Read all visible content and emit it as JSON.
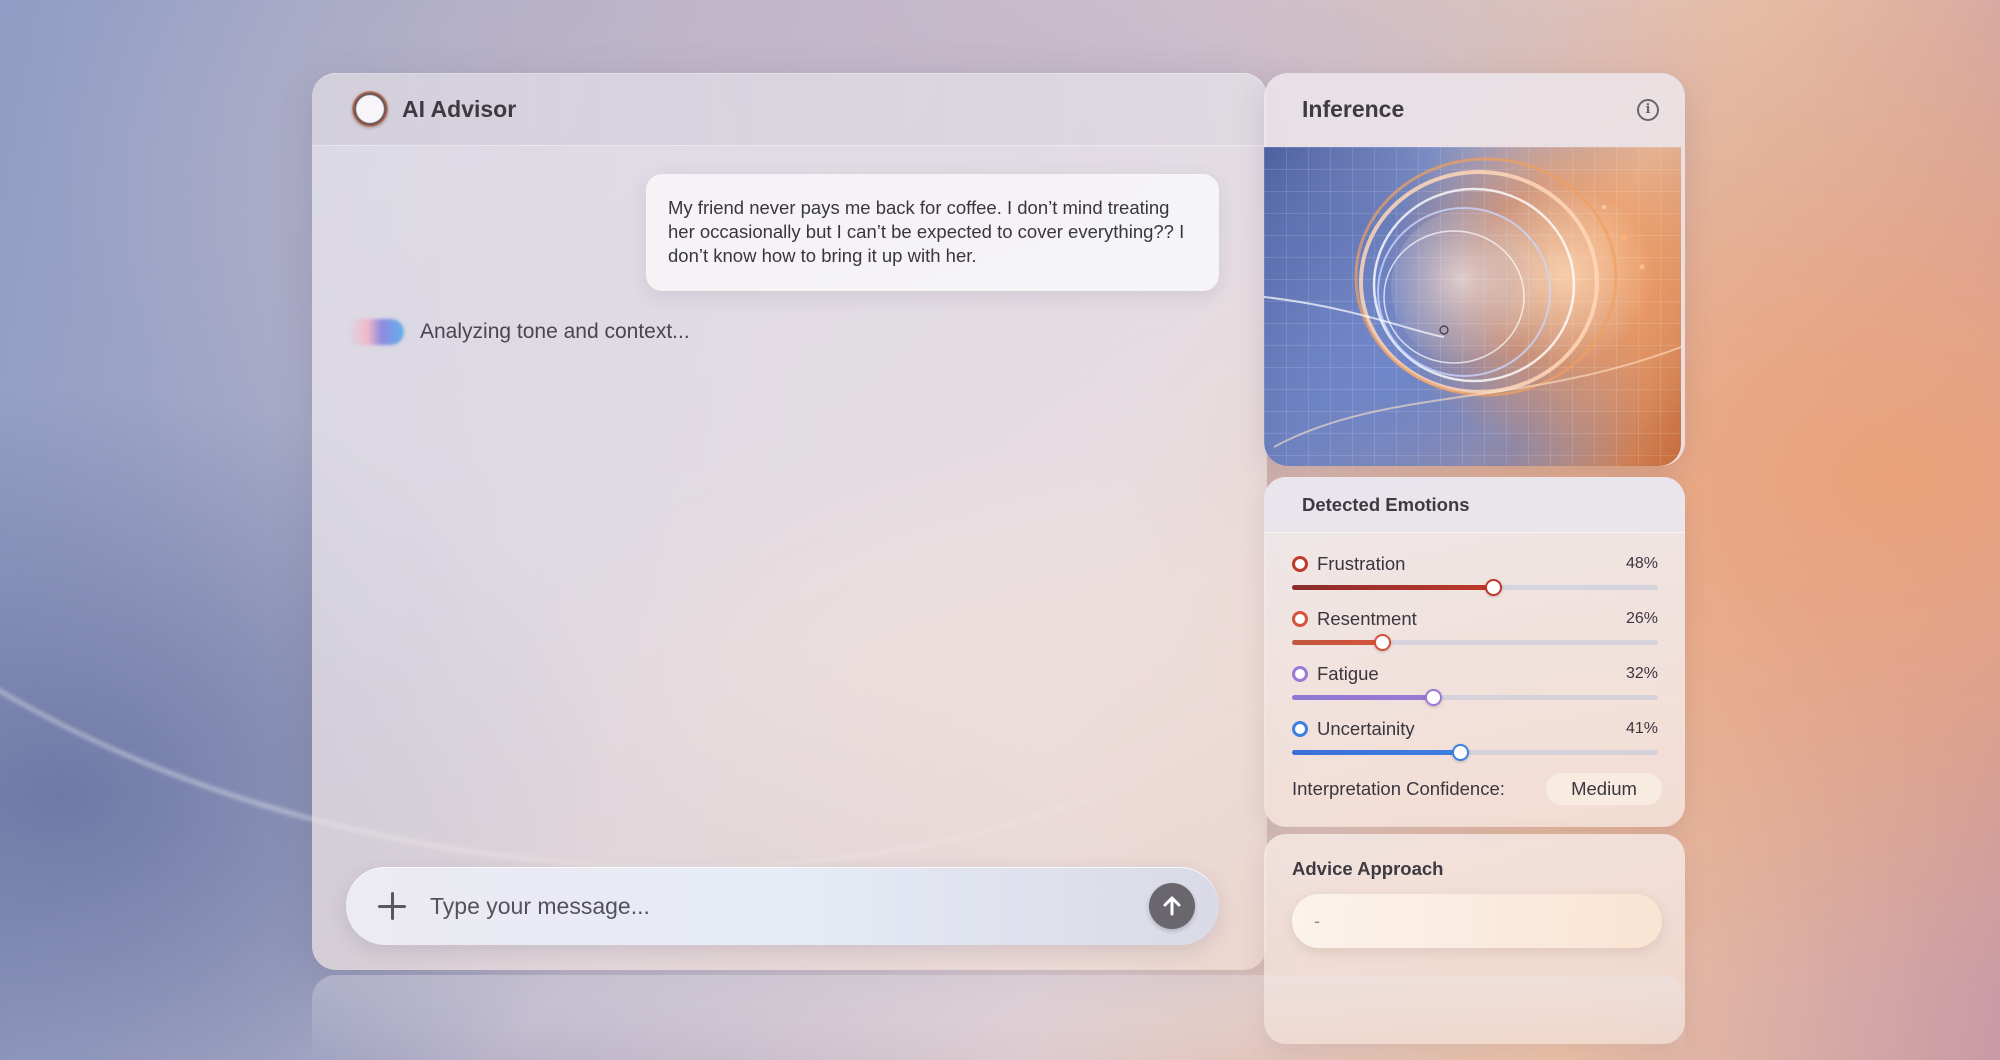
{
  "app": {
    "title": "AI Advisor"
  },
  "chat": {
    "user_message": "My friend never pays me back for coffee. I don’t mind treating her occasionally but I can’t be expected to cover everything?? I don’t know how to bring it up with her.",
    "status_text": "Analyzing tone and context...",
    "composer_placeholder": "Type your message..."
  },
  "inference": {
    "title": "Inference",
    "info_icon": "info-icon"
  },
  "emotions": {
    "title": "Detected Emotions",
    "items": [
      {
        "name": "Frustration",
        "percent_label": "48%",
        "value": 0.55,
        "color": "#c0392b",
        "fill_start": "#8a2b2b"
      },
      {
        "name": "Resentment",
        "percent_label": "26%",
        "value": 0.245,
        "color": "#d4533a",
        "fill_start": "#c0573e"
      },
      {
        "name": "Fatigue",
        "percent_label": "32%",
        "value": 0.385,
        "color": "#9a7ad6",
        "fill_start": "#8e78d2"
      },
      {
        "name": "Uncertainity",
        "percent_label": "41%",
        "value": 0.46,
        "color": "#3f7fe0",
        "fill_start": "#3a6fd8"
      }
    ],
    "confidence_label": "Interpretation Confidence:",
    "confidence_value": "Medium"
  },
  "advice": {
    "title": "Advice Approach",
    "value": "-"
  },
  "icons": {
    "composer_add": "plus-icon",
    "send": "arrow-up-icon",
    "logo": "logo-ring-icon"
  }
}
